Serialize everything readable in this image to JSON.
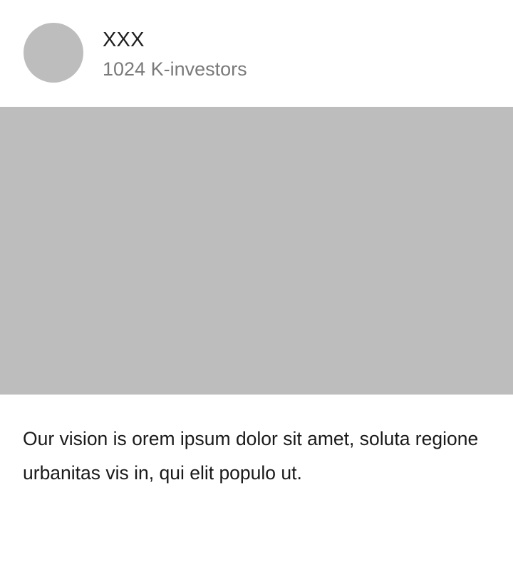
{
  "card": {
    "title": "XXX",
    "subtitle": "1024 K-investors",
    "description": "Our vision is orem ipsum dolor sit amet, soluta regione urbanitas vis in, qui elit populo ut."
  },
  "colors": {
    "placeholder": "#bdbdbd",
    "title_text": "#1f1f1f",
    "subtitle_text": "#7a7a7a",
    "body_text": "#1a1a1a",
    "background": "#ffffff"
  }
}
